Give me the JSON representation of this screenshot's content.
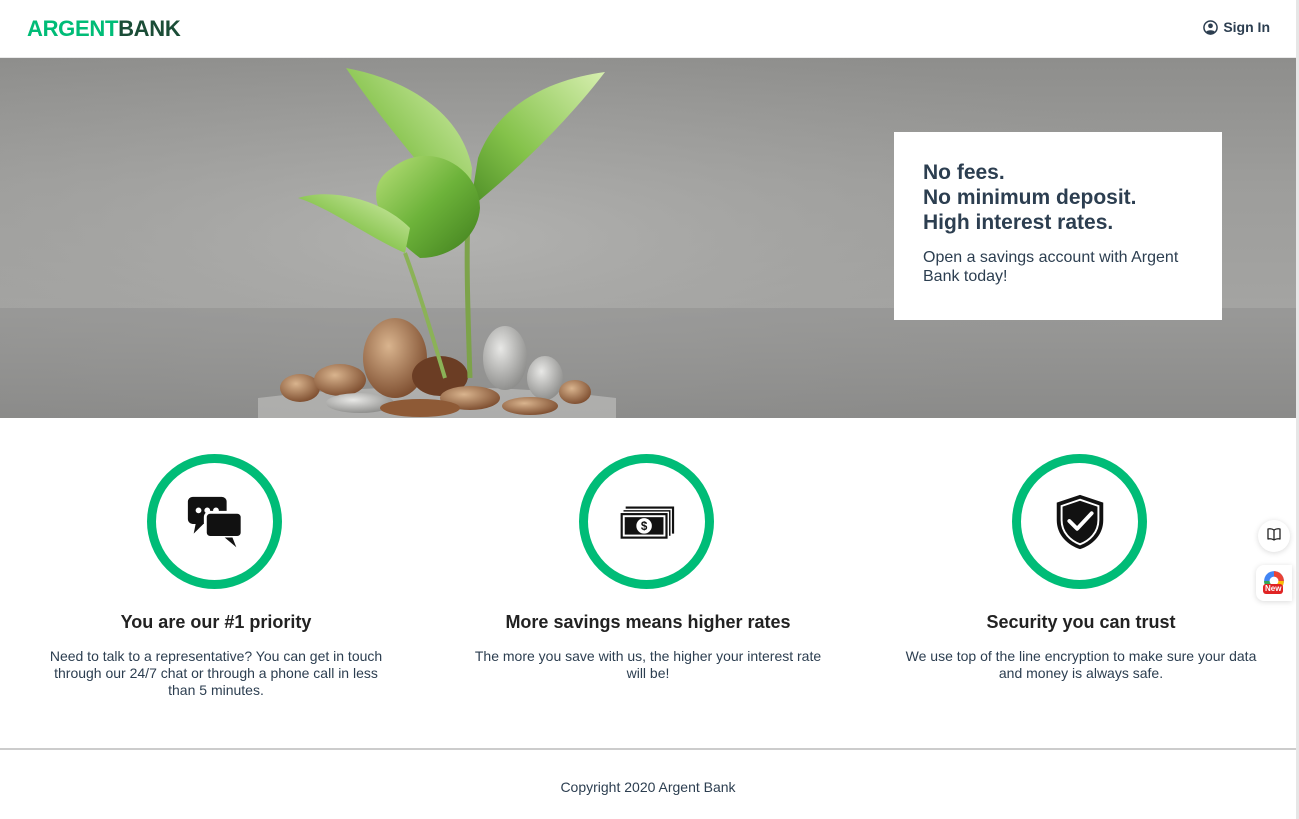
{
  "nav": {
    "logo_part1": "ARGENT",
    "logo_part2": "BANK",
    "signin_label": "Sign In"
  },
  "hero": {
    "headline_line1": "No fees.",
    "headline_line2": "No minimum deposit.",
    "headline_line3": "High interest rates.",
    "subtext": "Open a savings account with Argent Bank today!"
  },
  "features": [
    {
      "icon": "chat-icon",
      "title": "You are our #1 priority",
      "text": "Need to talk to a representative? You can get in touch through our 24/7 chat or through a phone call in less than 5 minutes."
    },
    {
      "icon": "money-icon",
      "title": "More savings means higher rates",
      "text": "The more you save with us, the higher your interest rate will be!"
    },
    {
      "icon": "security-icon",
      "title": "Security you can trust",
      "text": "We use top of the line encryption to make sure your data and money is always safe."
    }
  ],
  "footer": {
    "copyright": "Copyright 2020 Argent Bank"
  },
  "widgets": {
    "new_badge": "New"
  },
  "colors": {
    "accent": "#00bc77",
    "logo_dark": "#1b4d37",
    "text": "#2c3e50"
  }
}
